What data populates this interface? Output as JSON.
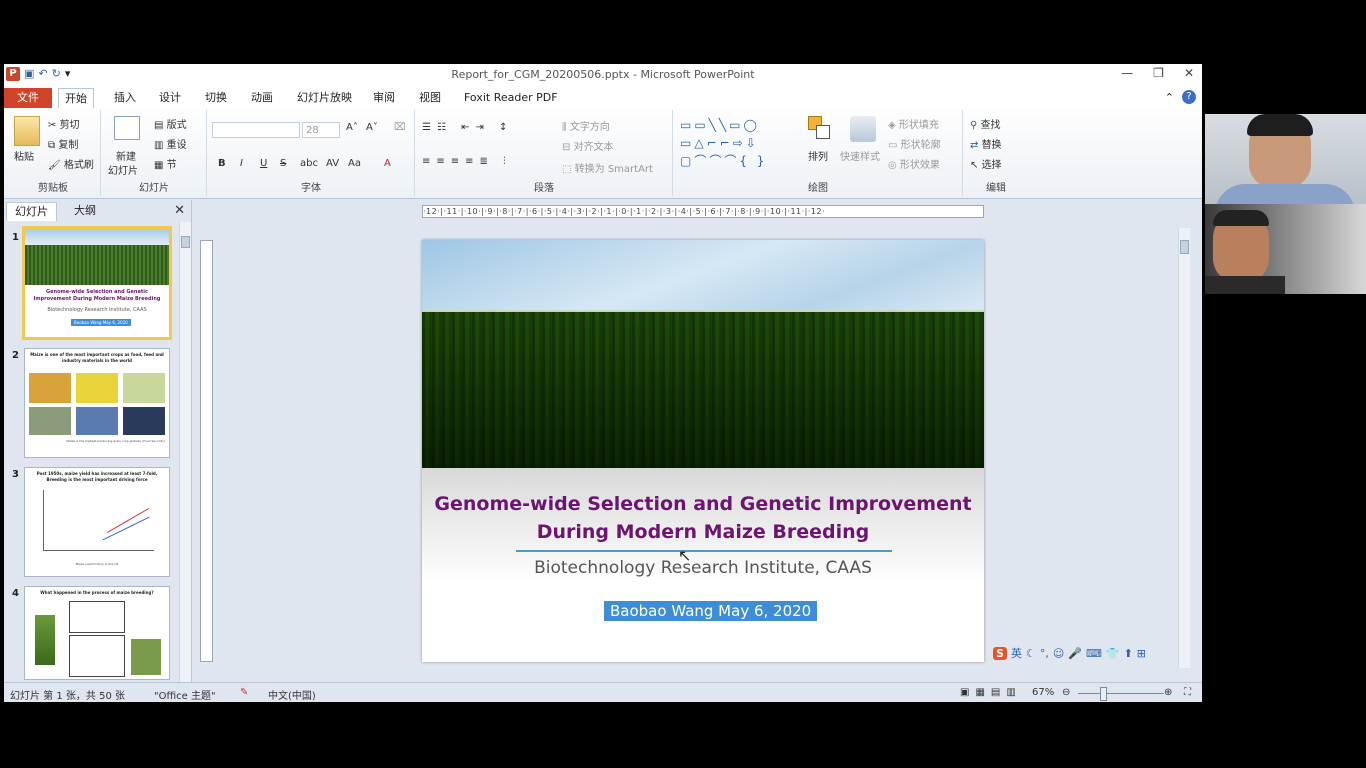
{
  "window": {
    "title": "Report_for_CGM_20200506.pptx - Microsoft PowerPoint",
    "controls": [
      "—",
      "❐",
      "✕"
    ]
  },
  "tabs": [
    "文件",
    "开始",
    "插入",
    "设计",
    "切换",
    "动画",
    "幻灯片放映",
    "审阅",
    "视图",
    "Foxit Reader PDF"
  ],
  "ribbon": {
    "clipboard": {
      "paste": "粘贴",
      "cut": "剪切",
      "copy": "复制",
      "format_painter": "格式刷",
      "label": "剪贴板"
    },
    "slides": {
      "new_slide": "新建",
      "new_slide2": "幻灯片",
      "layout": "版式",
      "reset": "重设",
      "section": "节",
      "label": "幻灯片"
    },
    "font": {
      "size": "28",
      "bold": "B",
      "italic": "I",
      "underline": "U",
      "strike": "S",
      "shadow": "abc",
      "spacing": "AV",
      "case": "Aa",
      "label": "字体"
    },
    "paragraph": {
      "text_direction": "文字方向",
      "align_text": "对齐文本",
      "smartart": "转换为 SmartArt",
      "label": "段落"
    },
    "drawing": {
      "arrange": "排列",
      "quick_styles": "快速样式",
      "shape_fill": "形状填充",
      "shape_outline": "形状轮廓",
      "shape_effects": "形状效果",
      "label": "绘图"
    },
    "editing": {
      "find": "查找",
      "replace": "替换",
      "select": "选择",
      "label": "编辑"
    }
  },
  "panel": {
    "tab_slides": "幻灯片",
    "tab_outline": "大纲",
    "thumbs": [
      {
        "num": "1",
        "title": "Genome-wide Selection and Genetic Improvement During Modern Maize Breeding",
        "sub": "Biotechnology Research Institute, CAAS",
        "author": "Baobao Wang May 6, 2020"
      },
      {
        "num": "2",
        "title": "Maize is one of the most important crops as food, feed and industry materials in the world",
        "caption": "Maize is the highest producing grain crop globally (Food Security)"
      },
      {
        "num": "3",
        "title": "Post 1950s, maize yield has increased at least 7-fold, Breeding is the most important driving force",
        "caption": "Maize yield history in the US"
      },
      {
        "num": "4",
        "title": "What happened in the process of maize breeding?"
      }
    ]
  },
  "ruler": "·12·|·11·|·10·|·9·|·8·|·7·|·6·|·5·|·4·|·3·|·2·|·1·|·0·|·1·|·2·|·3·|·4·|·5·|·6·|·7·|·8·|·9·|·10·|·11·|·12·",
  "slide": {
    "title_line1": "Genome-wide Selection and Genetic Improvement",
    "title_line2": "During Modern Maize Breeding",
    "subtitle": "Biotechnology  Research Institute, CAAS",
    "author": "Baobao Wang  May 6, 2020"
  },
  "status": {
    "slide_count": "幻灯片 第 1 张，共 50 张",
    "theme": "\"Office 主题\"",
    "language": "中文(中国)",
    "zoom": "67%"
  },
  "ime": [
    "S",
    "英",
    "☾",
    "°,",
    "☺",
    "🎤",
    "⌨",
    "👕",
    "⬆",
    "⊞"
  ],
  "colors": {
    "accent": "#d0442a",
    "title": "#6c1570",
    "author_bg": "#3d8ed6"
  }
}
